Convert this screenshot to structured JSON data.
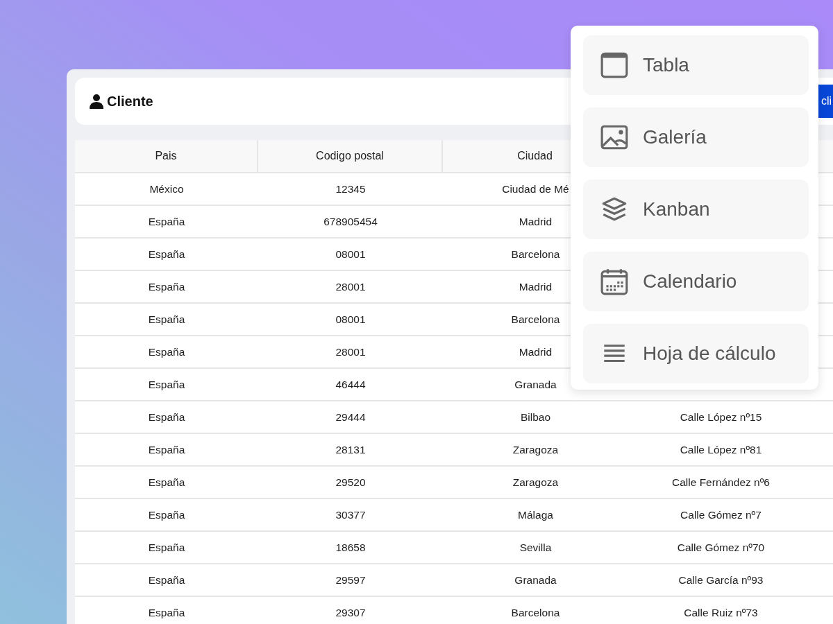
{
  "header": {
    "title": "Cliente",
    "button": "cli"
  },
  "table": {
    "columns": [
      "Pais",
      "Codigo postal",
      "Ciudad"
    ],
    "rows": [
      {
        "cells": [
          "México",
          "12345",
          "Ciudad de Mé"
        ]
      },
      {
        "cells": [
          "España",
          "678905454",
          "Madrid"
        ]
      },
      {
        "cells": [
          "España",
          "08001",
          "Barcelona"
        ]
      },
      {
        "cells": [
          "España",
          "28001",
          "Madrid"
        ]
      },
      {
        "cells": [
          "España",
          "08001",
          "Barcelona"
        ]
      },
      {
        "cells": [
          "España",
          "28001",
          "Madrid"
        ]
      },
      {
        "cells": [
          "España",
          "46444",
          "Granada"
        ]
      },
      {
        "cells": [
          "España",
          "29444",
          "Bilbao",
          "Calle López nº15"
        ]
      },
      {
        "cells": [
          "España",
          "28131",
          "Zaragoza",
          "Calle López nº81"
        ]
      },
      {
        "cells": [
          "España",
          "29520",
          "Zaragoza",
          "Calle Fernández nº6"
        ]
      },
      {
        "cells": [
          "España",
          "30377",
          "Málaga",
          "Calle Gómez nº7"
        ]
      },
      {
        "cells": [
          "España",
          "18658",
          "Sevilla",
          "Calle Gómez nº70"
        ]
      },
      {
        "cells": [
          "España",
          "29597",
          "Granada",
          "Calle García nº93"
        ]
      },
      {
        "cells": [
          "España",
          "29307",
          "Barcelona",
          "Calle Ruiz nº73"
        ]
      }
    ]
  },
  "view_menu": {
    "items": [
      {
        "label": "Tabla"
      },
      {
        "label": "Galería"
      },
      {
        "label": "Kanban"
      },
      {
        "label": "Calendario"
      },
      {
        "label": "Hoja de cálculo"
      }
    ]
  }
}
